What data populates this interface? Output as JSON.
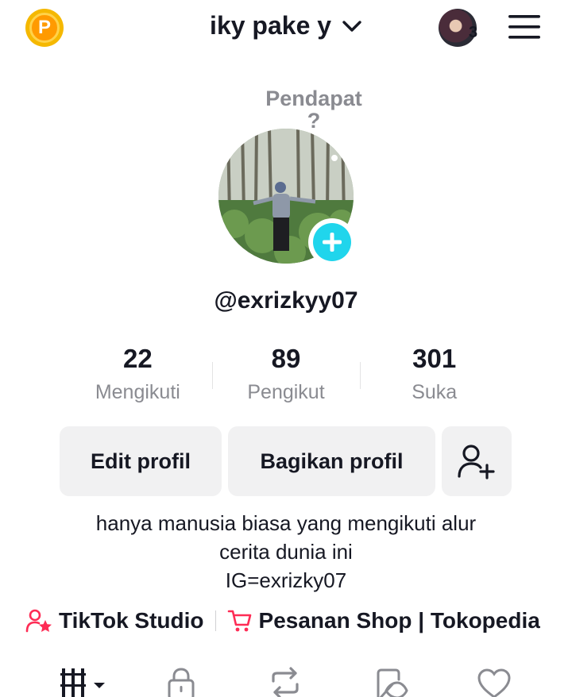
{
  "header": {
    "coin_letter": "P",
    "username": "iky pake y",
    "avatar_badge": "3"
  },
  "profile": {
    "opinion_line1": "Pendapat",
    "opinion_line2": "?",
    "handle": "@exrizkyy07",
    "stats": [
      {
        "value": "22",
        "label": "Mengikuti"
      },
      {
        "value": "89",
        "label": "Pengikut"
      },
      {
        "value": "301",
        "label": "Suka"
      }
    ],
    "buttons": {
      "edit": "Edit profil",
      "share": "Bagikan profil"
    },
    "bio": [
      "hanya manusia biasa yang mengikuti alur",
      "cerita dunia ini",
      "IG=exrizky07"
    ],
    "links": {
      "studio": "TikTok Studio",
      "shop": "Pesanan Shop | Tokopedia"
    }
  },
  "colors": {
    "accent_cyan": "#20d5ec",
    "accent_pink": "#fe2c55",
    "button_bg": "#f1f1f2",
    "secondary_text": "#8a8b91"
  },
  "icons": {
    "coin": "coin-icon",
    "dropdown": "chevron-down-icon",
    "menu": "hamburger-menu-icon",
    "add_friend": "add-user-icon",
    "studio": "creator-star-icon",
    "shop": "cart-icon",
    "tabs": [
      "grid-icon",
      "lock-icon",
      "repost-icon",
      "hidden-icon",
      "heart-icon"
    ]
  }
}
